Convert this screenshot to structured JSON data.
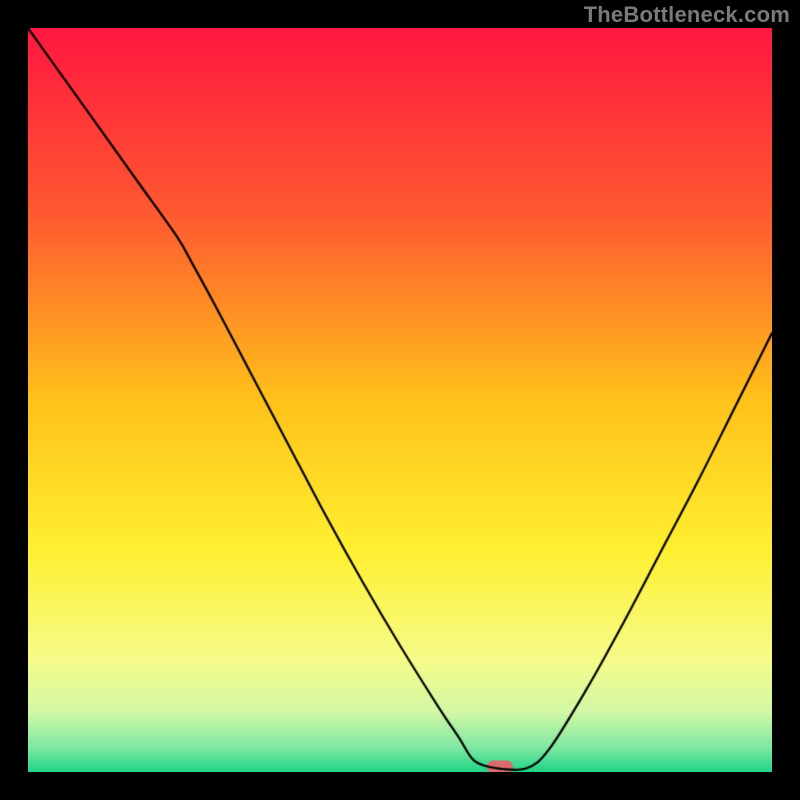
{
  "watermark": "TheBottleneck.com",
  "marker": {
    "x_frac": 0.635,
    "y_frac": 0.993
  },
  "chart_data": {
    "type": "line",
    "title": "",
    "xlabel": "",
    "ylabel": "",
    "xlim": [
      0,
      100
    ],
    "ylim": [
      0,
      100
    ],
    "x": [
      0,
      5,
      10,
      15,
      20,
      22,
      25,
      30,
      35,
      40,
      45,
      50,
      55,
      58,
      60,
      63,
      67,
      70,
      75,
      80,
      85,
      90,
      95,
      100
    ],
    "y": [
      100,
      93,
      86,
      79,
      72,
      68.5,
      63,
      53.5,
      44,
      34.5,
      25.5,
      17,
      9,
      4.5,
      1.5,
      0.5,
      0.5,
      3,
      11,
      20,
      29.5,
      39,
      49,
      59
    ],
    "series": [
      {
        "name": "bottleneck-curve",
        "color": "#000000"
      }
    ],
    "gradient_stops": [
      {
        "t": 0.0,
        "color": "#ff1840"
      },
      {
        "t": 0.25,
        "color": "#ff5a30"
      },
      {
        "t": 0.5,
        "color": "#ffc21a"
      },
      {
        "t": 0.7,
        "color": "#fff030"
      },
      {
        "t": 0.85,
        "color": "#f6fc8a"
      },
      {
        "t": 0.92,
        "color": "#d2f8a6"
      },
      {
        "t": 0.97,
        "color": "#7be8a2"
      },
      {
        "t": 1.0,
        "color": "#20d487"
      }
    ]
  }
}
